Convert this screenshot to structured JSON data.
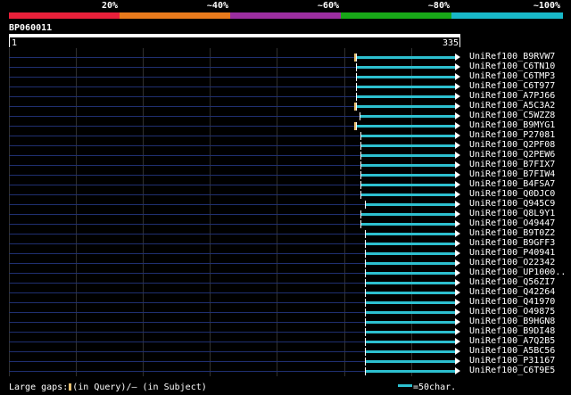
{
  "identity_bar": {
    "labels": [
      "20%",
      "~40%",
      "~60%",
      "~80%",
      "~100%"
    ],
    "colors": [
      "#e8203a",
      "#e87a1c",
      "#9c2ea0",
      "#18a818",
      "#18b8c8"
    ]
  },
  "query": {
    "name": "BP060011",
    "start_label": "1",
    "end_label": "335",
    "length": 335
  },
  "hits": [
    {
      "name": "UniRef100_B9RVW7",
      "start": 335,
      "gap": true
    },
    {
      "name": "UniRef100_C6TN10",
      "start": 335,
      "gap": false
    },
    {
      "name": "UniRef100_C6TMP3",
      "start": 335,
      "gap": false
    },
    {
      "name": "UniRef100_C6T977",
      "start": 335,
      "gap": false
    },
    {
      "name": "UniRef100_A7PJ66",
      "start": 335,
      "gap": false
    },
    {
      "name": "UniRef100_A5C3A2",
      "start": 335,
      "gap": true
    },
    {
      "name": "UniRef100_C5WZZ8",
      "start": 339,
      "gap": false
    },
    {
      "name": "UniRef100_B9MYG1",
      "start": 335,
      "gap": true
    },
    {
      "name": "UniRef100_P27081",
      "start": 340,
      "gap": false
    },
    {
      "name": "UniRef100_Q2PF08",
      "start": 340,
      "gap": false
    },
    {
      "name": "UniRef100_Q2PEW6",
      "start": 340,
      "gap": false
    },
    {
      "name": "UniRef100_B7FIX7",
      "start": 340,
      "gap": false
    },
    {
      "name": "UniRef100_B7FIW4",
      "start": 340,
      "gap": false
    },
    {
      "name": "UniRef100_B4FSA7",
      "start": 340,
      "gap": false
    },
    {
      "name": "UniRef100_Q0DJC0",
      "start": 340,
      "gap": false
    },
    {
      "name": "UniRef100_Q945C9",
      "start": 344,
      "gap": false
    },
    {
      "name": "UniRef100_Q8L9Y1",
      "start": 340,
      "gap": false
    },
    {
      "name": "UniRef100_O49447",
      "start": 340,
      "gap": false
    },
    {
      "name": "UniRef100_B9T0Z2",
      "start": 344,
      "gap": false
    },
    {
      "name": "UniRef100_B9GFF3",
      "start": 344,
      "gap": false
    },
    {
      "name": "UniRef100_P40941",
      "start": 344,
      "gap": false
    },
    {
      "name": "UniRef100_O22342",
      "start": 344,
      "gap": false
    },
    {
      "name": "UniRef100_UP1000..",
      "start": 344,
      "gap": false
    },
    {
      "name": "UniRef100_Q56ZI7",
      "start": 344,
      "gap": false
    },
    {
      "name": "UniRef100_Q42264",
      "start": 344,
      "gap": false
    },
    {
      "name": "UniRef100_Q41970",
      "start": 344,
      "gap": false
    },
    {
      "name": "UniRef100_O49875",
      "start": 344,
      "gap": false
    },
    {
      "name": "UniRef100_B9HGN8",
      "start": 344,
      "gap": false
    },
    {
      "name": "UniRef100_B9DI48",
      "start": 344,
      "gap": false
    },
    {
      "name": "UniRef100_A7Q2B5",
      "start": 344,
      "gap": false
    },
    {
      "name": "UniRef100_A5BC56",
      "start": 344,
      "gap": false
    },
    {
      "name": "UniRef100_P31167",
      "start": 344,
      "gap": false
    },
    {
      "name": "UniRef100_C6T9E5",
      "start": 344,
      "gap": false
    }
  ],
  "footer": {
    "gaps_prefix": "Large gaps:",
    "gaps_query": "(in Query)/",
    "gaps_dash": "–",
    "gaps_subject": " (in Subject)",
    "scale_text": "=50char."
  },
  "colors": {
    "hit_bar": "#2dc0d0",
    "row_line": "#1f2f70",
    "gap_mark": "#e8c070",
    "grid": "#303030"
  }
}
